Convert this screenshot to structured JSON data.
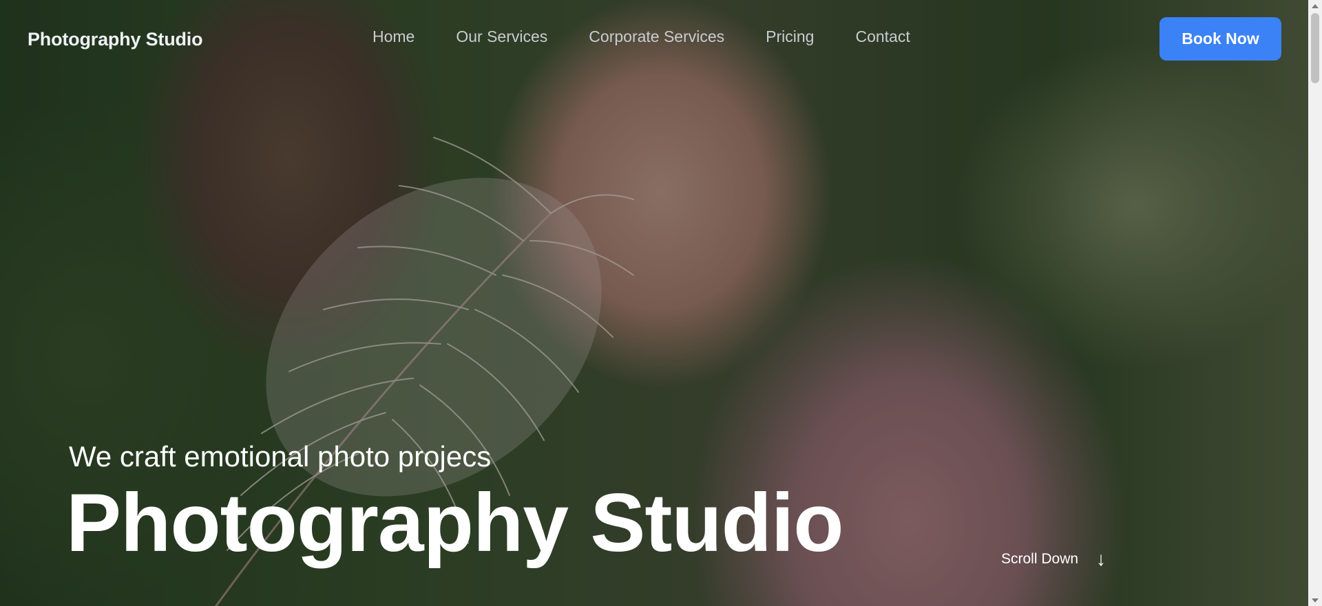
{
  "header": {
    "brand": "Photography Studio",
    "nav": [
      {
        "label": "Home"
      },
      {
        "label": "Our Services"
      },
      {
        "label": "Corporate Services"
      },
      {
        "label": "Pricing"
      },
      {
        "label": "Contact"
      }
    ],
    "cta_label": "Book Now"
  },
  "hero": {
    "tagline": "We craft emotional photo projecs",
    "title": "Photography Studio",
    "scroll_label": "Scroll Down",
    "scroll_icon": "arrow-down-icon",
    "background_image": "portrait of a woman with eyes closed holding a white feather, blurred green garden behind"
  },
  "colors": {
    "cta_background": "#3b82f6",
    "nav_text": "#c9ccd1",
    "hero_text": "#ffffff"
  }
}
